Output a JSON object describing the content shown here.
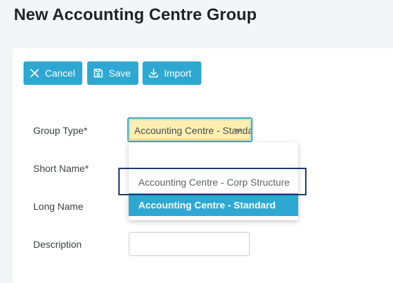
{
  "page": {
    "title": "New Accounting Centre Group"
  },
  "toolbar": {
    "cancel_label": "Cancel",
    "save_label": "Save",
    "import_label": "Import"
  },
  "form": {
    "group_type_label": "Group Type*",
    "short_name_label": "Short Name*",
    "long_name_label": "Long Name",
    "description_label": "Description",
    "group_type_value": "Accounting Centre - Standa",
    "description_value": ""
  },
  "dropdown": {
    "options": [
      "",
      "Accounting Centre - Corp Structure",
      "Accounting Centre - Standard"
    ],
    "selected": "Accounting Centre - Standard"
  },
  "colors": {
    "accent": "#2ea8d2",
    "select_highlight": "#fcefb0",
    "focus_outline": "#1d3a6b"
  },
  "icons": {
    "cancel": "close-icon",
    "save": "save-icon",
    "import": "download-icon",
    "select": "chevron-down-icon"
  }
}
